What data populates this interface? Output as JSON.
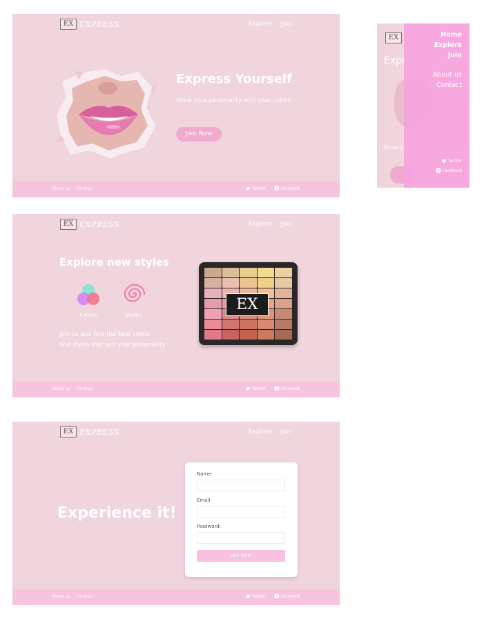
{
  "brand": {
    "logo_mark": "EX",
    "logo_word": "EXPRESS"
  },
  "nav": {
    "explore": "Explore",
    "join": "Join"
  },
  "footer": {
    "about": "About us",
    "contact": "Contact",
    "twitter": "Twitter",
    "facebook": "Facebook"
  },
  "home": {
    "title": "Express Yourself",
    "subtitle": "Show your personality with your colors",
    "cta": "Join Now"
  },
  "explore": {
    "title": "Explore new styles",
    "colors_label": "Colors",
    "styles_label": "Styles",
    "description_line1": "Join us and find the best colors",
    "description_line2": "and styles that suit your personality",
    "palette_logo": "EX",
    "palette_colors": [
      "#c9a98a",
      "#d9c09a",
      "#e8cf8e",
      "#f0dc8f",
      "#e8d3a0",
      "#d8b0a0",
      "#e8c0b0",
      "#e9c48e",
      "#f2d08a",
      "#e6c9a5",
      "#e8b0b8",
      "#f0b4b0",
      "#eeb89c",
      "#f0be90",
      "#e2b39a",
      "#e89aa8",
      "#e79a9a",
      "#e2a090",
      "#eca38a",
      "#dba086",
      "#f0a0b4",
      "#de8a8a",
      "#dc8b7a",
      "#e0967a",
      "#c98872",
      "#e98b98",
      "#d2756f",
      "#cf7560",
      "#d8896f",
      "#b87a66",
      "#e07a88",
      "#c86462",
      "#c2624e",
      "#cb7a5c",
      "#a86a55"
    ]
  },
  "join": {
    "title": "Experience it!",
    "name_label": "Name:",
    "email_label": "Email:",
    "password_label": "Password:",
    "submit": "Join Now"
  },
  "mobile": {
    "logo_mark": "EX",
    "peek_title": "Expr",
    "peek_sub": "Show y",
    "menu": [
      "Home",
      "Explore",
      "Join"
    ],
    "secondary": [
      "About us",
      "Contact"
    ],
    "twitter": "Twitter",
    "facebook": "Facebook"
  },
  "colors": {
    "frame_bg": "#f0d5dc",
    "footer_bg": "#f6c4dd",
    "button": "#f2a9ce",
    "drawer": "#f6a4de"
  }
}
